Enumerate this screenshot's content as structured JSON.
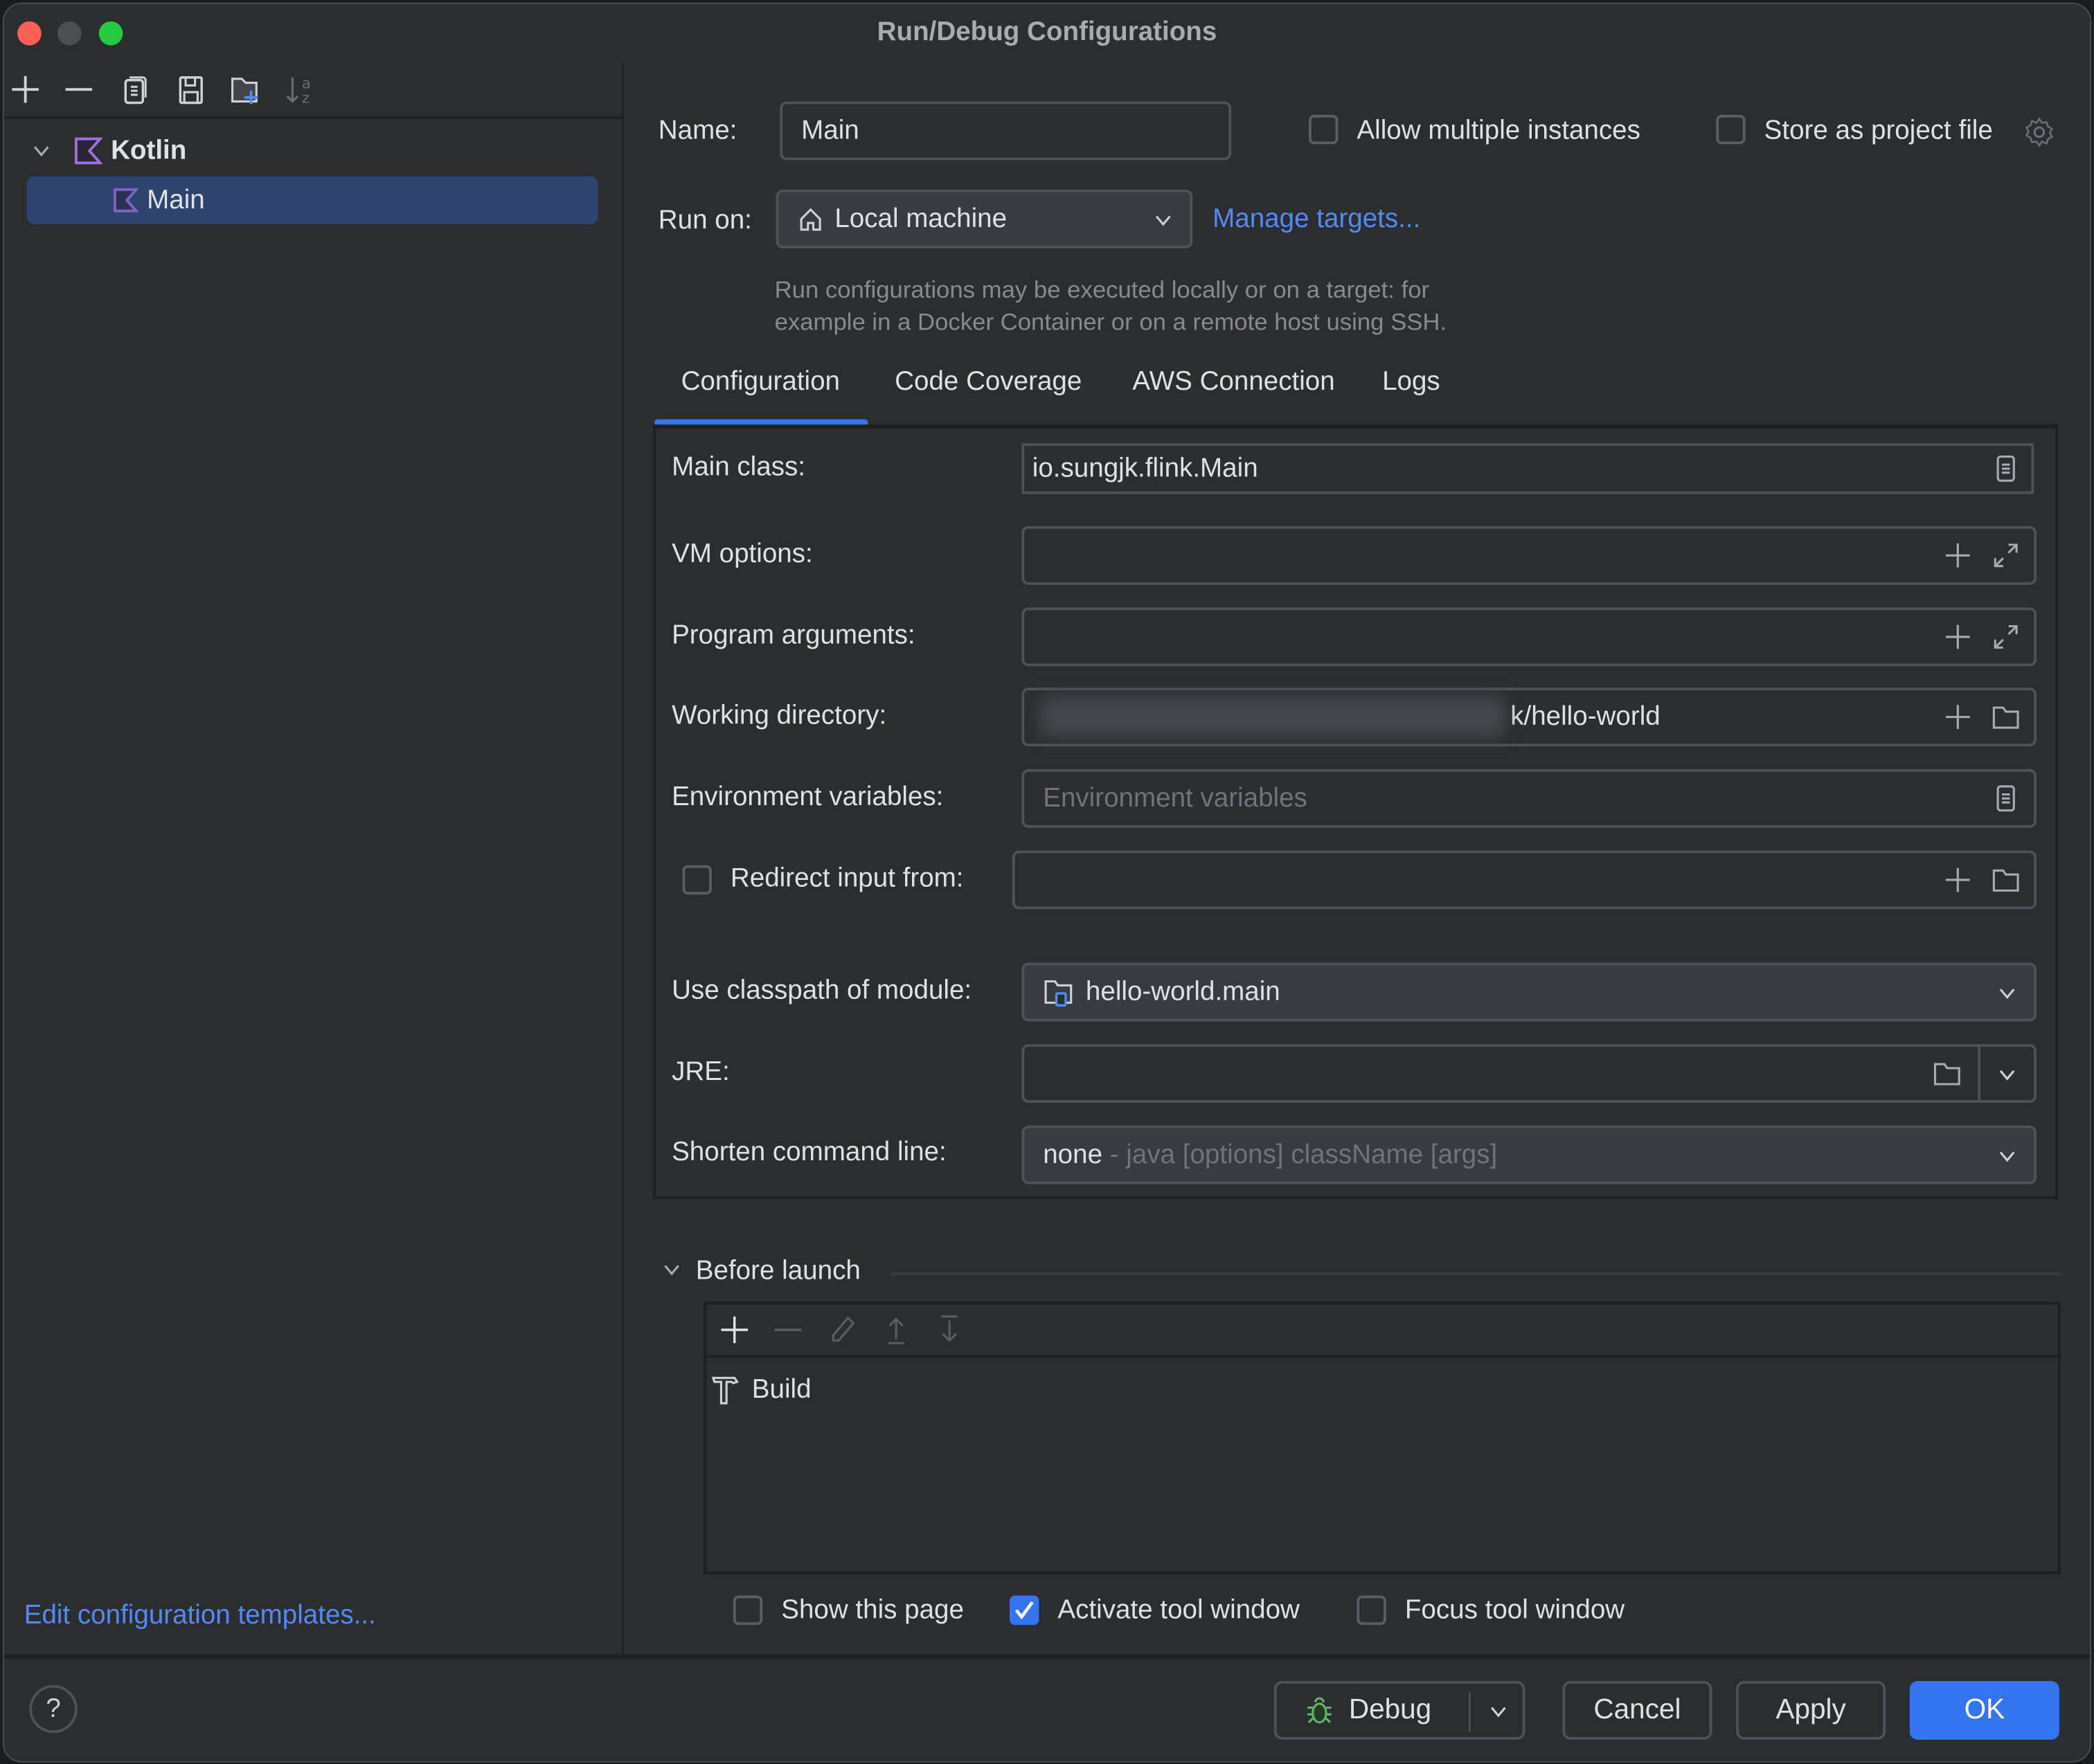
{
  "window": {
    "title": "Run/Debug Configurations"
  },
  "sidebar": {
    "toolbar": [
      {
        "icon": "plus-icon",
        "label": "Add"
      },
      {
        "icon": "minus-icon",
        "label": "Remove"
      },
      {
        "icon": "copy-icon",
        "label": "Copy"
      },
      {
        "icon": "save-icon",
        "label": "Save"
      },
      {
        "icon": "new-folder-icon",
        "label": "New Folder"
      },
      {
        "icon": "sort-alpha-icon",
        "label": "Sort"
      }
    ],
    "tree": {
      "group": {
        "label": "Kotlin",
        "expanded": true
      },
      "items": [
        {
          "label": "Main",
          "selected": true
        }
      ]
    },
    "edit_templates_link": "Edit configuration templates..."
  },
  "header": {
    "name_label": "Name:",
    "name_value": "Main",
    "allow_multiple_label": "Allow multiple instances",
    "allow_multiple_checked": false,
    "store_project_label": "Store as project file",
    "store_project_checked": false,
    "run_on_label": "Run on:",
    "run_on_value": "Local machine",
    "manage_targets_link": "Manage targets...",
    "run_on_hint_line1": "Run configurations may be executed locally or on a target: for",
    "run_on_hint_line2": "example in a Docker Container or on a remote host using SSH."
  },
  "tabs": [
    {
      "label": "Configuration",
      "active": true
    },
    {
      "label": "Code Coverage",
      "active": false
    },
    {
      "label": "AWS Connection",
      "active": false
    },
    {
      "label": "Logs",
      "active": false
    }
  ],
  "config": {
    "main_class_label": "Main class:",
    "main_class_value": "io.sungjk.flink.Main",
    "vm_options_label": "VM options:",
    "vm_options_value": "",
    "program_args_label": "Program arguments:",
    "program_args_value": "",
    "working_dir_label": "Working directory:",
    "working_dir_value_visible": "k/hello-world",
    "env_vars_label": "Environment variables:",
    "env_vars_placeholder": "Environment variables",
    "redirect_input_label": "Redirect input from:",
    "redirect_input_checked": false,
    "classpath_label": "Use classpath of module:",
    "classpath_value": "hello-world.main",
    "jre_label": "JRE:",
    "jre_value": "",
    "shorten_label": "Shorten command line:",
    "shorten_value": "none",
    "shorten_hint": " - java [options] className [args]"
  },
  "before_launch": {
    "title": "Before launch",
    "toolbar": [
      "plus-icon",
      "minus-icon",
      "edit-icon",
      "move-up-icon",
      "move-down-icon"
    ],
    "tasks": [
      {
        "label": "Build",
        "icon": "hammer-icon"
      }
    ],
    "show_this_page_label": "Show this page",
    "show_this_page_checked": false,
    "activate_tool_window_label": "Activate tool window",
    "activate_tool_window_checked": true,
    "focus_tool_window_label": "Focus tool window",
    "focus_tool_window_checked": false
  },
  "footer": {
    "help_label": "?",
    "debug_label": "Debug",
    "cancel_label": "Cancel",
    "apply_label": "Apply",
    "ok_label": "OK"
  },
  "colors": {
    "accent": "#3574f0",
    "link": "#548af7",
    "kotlin": "#a36ee0",
    "debug_green": "#5fb865",
    "selection": "#2e436e",
    "background": "#2b2d30"
  }
}
